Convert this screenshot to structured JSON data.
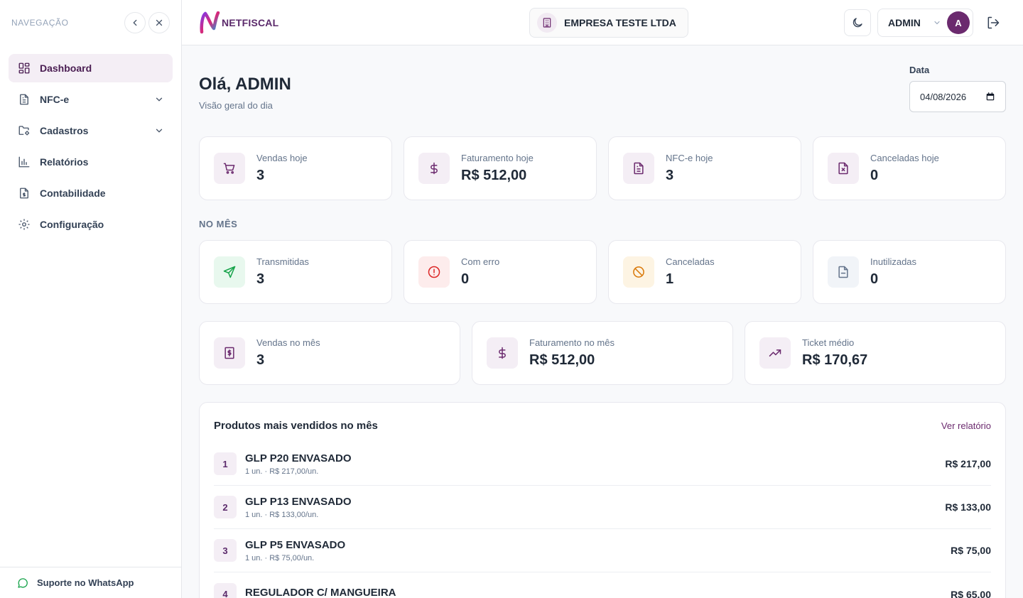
{
  "sidebar": {
    "title": "NAVEGAÇÃO",
    "items": [
      {
        "label": "Dashboard"
      },
      {
        "label": "NFC-e"
      },
      {
        "label": "Cadastros"
      },
      {
        "label": "Relatórios"
      },
      {
        "label": "Contabilidade"
      },
      {
        "label": "Configuração"
      }
    ],
    "support": "Suporte no WhatsApp"
  },
  "header": {
    "logo_prefix": "NET",
    "logo_suffix": "FISCAL",
    "company": "EMPRESA TESTE LTDA",
    "user": "ADMIN",
    "avatar_initial": "A"
  },
  "main": {
    "greeting": "Olá, ADMIN",
    "subtitle": "Visão geral do dia",
    "date_label": "Data",
    "date_value": "04/08/2026",
    "today": [
      {
        "label": "Vendas hoje",
        "value": "3"
      },
      {
        "label": "Faturamento hoje",
        "value": "R$ 512,00"
      },
      {
        "label": "NFC-e hoje",
        "value": "3"
      },
      {
        "label": "Canceladas hoje",
        "value": "0"
      }
    ],
    "month_section": "NO MÊS",
    "month": [
      {
        "label": "Transmitidas",
        "value": "3"
      },
      {
        "label": "Com erro",
        "value": "0"
      },
      {
        "label": "Canceladas",
        "value": "1"
      },
      {
        "label": "Inutilizadas",
        "value": "0"
      }
    ],
    "month_totals": [
      {
        "label": "Vendas no mês",
        "value": "3"
      },
      {
        "label": "Faturamento no mês",
        "value": "R$ 512,00"
      },
      {
        "label": "Ticket médio",
        "value": "R$ 170,67"
      }
    ],
    "products": {
      "title": "Produtos mais vendidos no mês",
      "link": "Ver relatório",
      "rows": [
        {
          "rank": "1",
          "name": "GLP P20 ENVASADO",
          "detail": "1 un. · R$ 217,00/un.",
          "total": "R$ 217,00"
        },
        {
          "rank": "2",
          "name": "GLP P13 ENVASADO",
          "detail": "1 un. · R$ 133,00/un.",
          "total": "R$ 133,00"
        },
        {
          "rank": "3",
          "name": "GLP P5 ENVASADO",
          "detail": "1 un. · R$ 75,00/un.",
          "total": "R$ 75,00"
        },
        {
          "rank": "4",
          "name": "REGULADOR C/ MANGUEIRA",
          "detail": "",
          "total": "R$ 65,00"
        }
      ]
    }
  },
  "colors": {
    "brand": "#6b2a6e",
    "active_bg": "#f4eef5",
    "success": "#16a34a",
    "error": "#dc2626",
    "warning": "#d97706"
  }
}
